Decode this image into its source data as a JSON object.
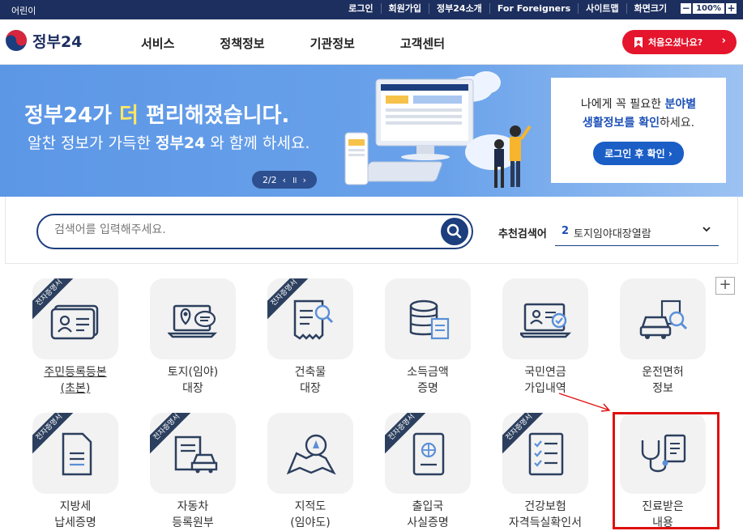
{
  "topbar": {
    "kids": "어린이",
    "links": [
      "로그인",
      "회원가입",
      "정부24소개",
      "For Foreigners",
      "사이트맵"
    ],
    "zoom_label": "화면크기",
    "zoom_minus": "−",
    "zoom_value": "100%",
    "zoom_plus": "+"
  },
  "header": {
    "logo_text": "정부24",
    "nav": [
      "서비스",
      "정책정보",
      "기관정보",
      "고객센터"
    ],
    "first_visit": "처음오셨나요?"
  },
  "banner": {
    "headline_a": "정부24가 ",
    "headline_hl": "더",
    "headline_b": " 편리해졌습니다.",
    "sub_a": "알찬 정보가 가득한 ",
    "sub_b": "정부24",
    "sub_c": " 와 함께 하세요.",
    "pager_text": "2/2",
    "pager_prev": "‹",
    "pager_pause": "॥",
    "pager_next": "›",
    "promo_line1_a": "나에게 꼭 필요한 ",
    "promo_line1_b": "분야별",
    "promo_line2_a": "생활정보를 확인",
    "promo_line2_b": "하세요.",
    "promo_button": "로그인 후 확인"
  },
  "search": {
    "placeholder": "검색어를 입력해주세요.",
    "recommend_label": "추천검색어",
    "recommend_num": "2",
    "recommend_value": "토지임야대장열람"
  },
  "services": {
    "ribbon": "전자증명서",
    "items": [
      {
        "line1": "주민등록등본",
        "line2": "(초본)"
      },
      {
        "line1": "토지(임야)",
        "line2": "대장"
      },
      {
        "line1": "건축물",
        "line2": "대장"
      },
      {
        "line1": "소득금액",
        "line2": "증명"
      },
      {
        "line1": "국민연금",
        "line2": "가입내역"
      },
      {
        "line1": "운전면허",
        "line2": "정보"
      },
      {
        "line1": "지방세",
        "line2": "납세증명"
      },
      {
        "line1": "자동차",
        "line2": "등록원부"
      },
      {
        "line1": "지적도",
        "line2": "(임야도)"
      },
      {
        "line1": "출입국",
        "line2": "사실증명"
      },
      {
        "line1": "건강보험",
        "line2": "자격득실확인서"
      },
      {
        "line1": "진료받은",
        "line2": "내용"
      }
    ],
    "more": "+"
  },
  "colors": {
    "navy": "#1c2f5e",
    "accent_red": "#e4152c",
    "banner_blue": "#5c97e6",
    "highlight_box": "#e01010"
  }
}
